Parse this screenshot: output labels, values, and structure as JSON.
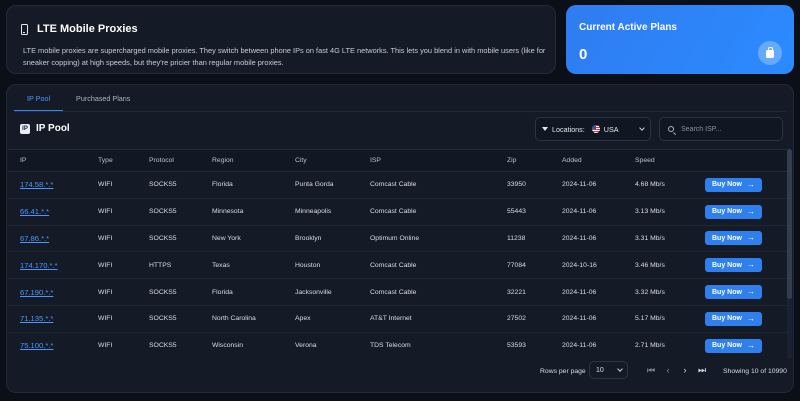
{
  "info": {
    "title": "LTE Mobile Proxies",
    "description": "LTE mobile proxies are supercharged mobile proxies. They switch between phone IPs on fast 4G LTE networks. This lets you blend in with mobile users (like for sneaker copping) at high speeds, but they're pricier than regular mobile proxies."
  },
  "plans": {
    "title": "Current Active Plans",
    "count": "0",
    "icon": "shopping-bag-icon"
  },
  "tabs": [
    {
      "label": "IP Pool",
      "active": true
    },
    {
      "label": "Purchased Plans",
      "active": false
    }
  ],
  "pool": {
    "title": "IP Pool",
    "location_label": "Locations:",
    "location_value": "USA",
    "search_placeholder": "Search ISP..."
  },
  "table": {
    "headers": [
      "IP",
      "Type",
      "Protocol",
      "Region",
      "City",
      "ISP",
      "Zip",
      "Added",
      "Speed",
      ""
    ],
    "buy_label": "Buy Now",
    "rows": [
      [
        "174.58.*.*",
        "WIFI",
        "SOCKS5",
        "Florida",
        "Punta Gorda",
        "Comcast Cable",
        "33950",
        "2024-11-06",
        "4.68 Mb/s"
      ],
      [
        "66.41.*.*",
        "WIFI",
        "SOCKS5",
        "Minnesota",
        "Minneapolis",
        "Comcast Cable",
        "55443",
        "2024-11-06",
        "3.13 Mb/s"
      ],
      [
        "67.86.*.*",
        "WIFI",
        "SOCKS5",
        "New York",
        "Brooklyn",
        "Optimum Online",
        "11238",
        "2024-11-06",
        "3.31 Mb/s"
      ],
      [
        "174.170.*.*",
        "WIFI",
        "HTTPS",
        "Texas",
        "Houston",
        "Comcast Cable",
        "77084",
        "2024-10-16",
        "3.46 Mb/s"
      ],
      [
        "67.190.*.*",
        "WIFI",
        "SOCKS5",
        "Florida",
        "Jacksonville",
        "Comcast Cable",
        "32221",
        "2024-11-06",
        "3.32 Mb/s"
      ],
      [
        "71.135.*.*",
        "WIFI",
        "SOCKS5",
        "North Carolina",
        "Apex",
        "AT&T Internet",
        "27502",
        "2024-11-06",
        "5.17 Mb/s"
      ],
      [
        "75.100.*.*",
        "WIFI",
        "SOCKS5",
        "Wisconsin",
        "Verona",
        "TDS Telecom",
        "53593",
        "2024-11-06",
        "2.71 Mb/s"
      ]
    ]
  },
  "footer": {
    "rows_per_page_label": "Rows per page",
    "rows_per_page_value": "10",
    "showing": "Showing 10 of 10990"
  },
  "colors": {
    "accent": "#2f80ed",
    "background": "#0b0f17",
    "card": "#151b26"
  }
}
